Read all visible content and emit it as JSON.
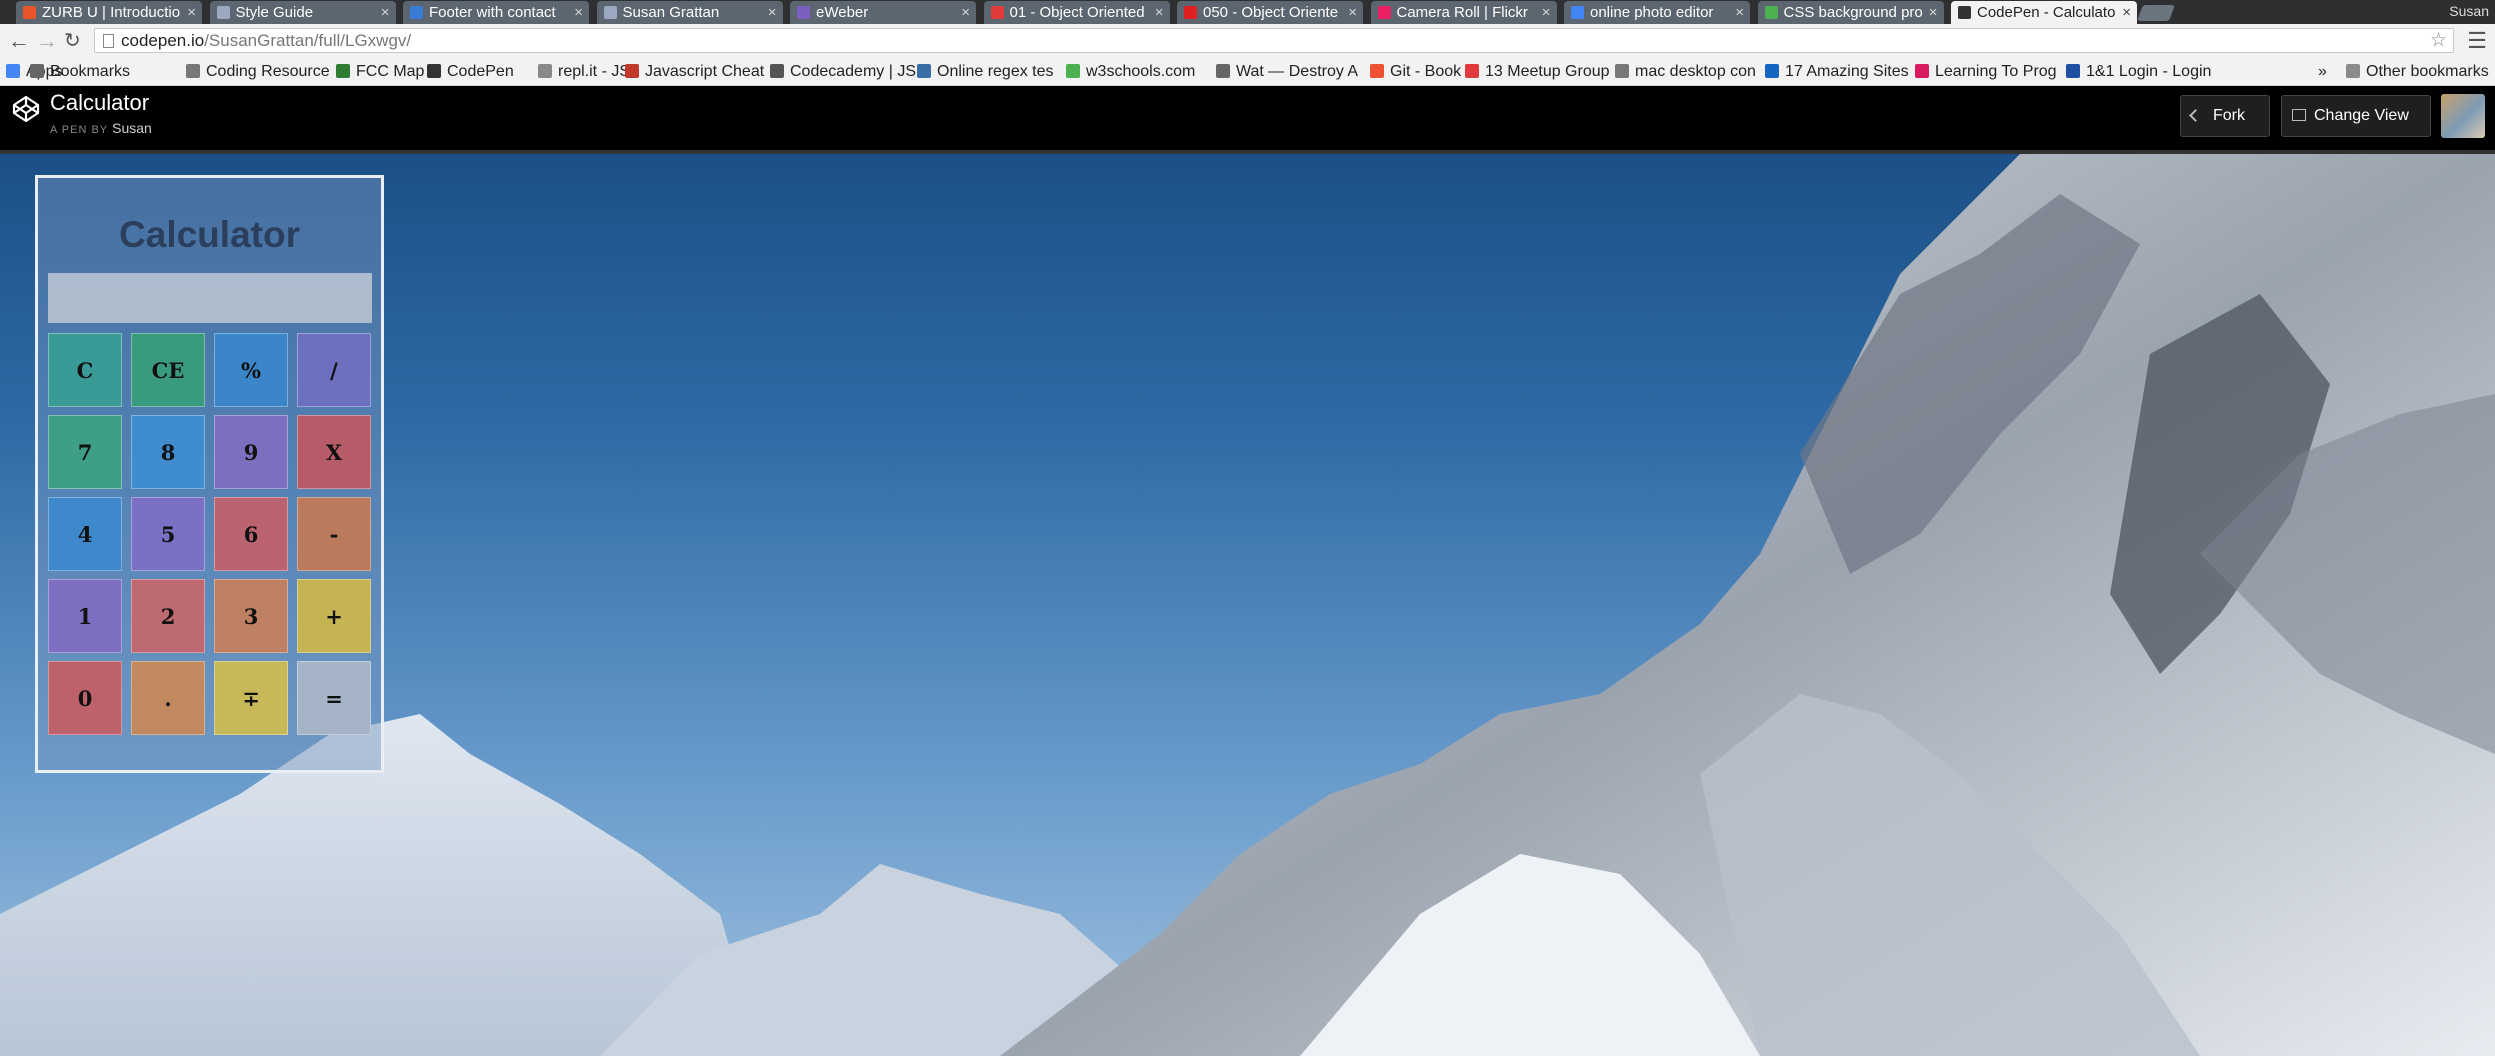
{
  "browser": {
    "tabs": [
      {
        "label": "ZURB U | Introductio",
        "favicon_color": "#e8552a"
      },
      {
        "label": "Style Guide",
        "favicon_color": "#9aa9c0"
      },
      {
        "label": "Footer with contact",
        "favicon_color": "#3a7bd5"
      },
      {
        "label": "Susan Grattan",
        "favicon_color": "#9aa9c0"
      },
      {
        "label": "eWeber",
        "favicon_color": "#7a5fbf"
      },
      {
        "label": "01 - Object Oriented",
        "favicon_color": "#e23b3b"
      },
      {
        "label": "050 - Object Oriente",
        "favicon_color": "#e02020"
      },
      {
        "label": "Camera Roll | Flickr",
        "favicon_color": "#e91e63"
      },
      {
        "label": "online photo editor",
        "favicon_color": "#4285f4"
      },
      {
        "label": "CSS background pro",
        "favicon_color": "#4caf50"
      },
      {
        "label": "CodePen - Calculato",
        "favicon_color": "#333333"
      }
    ],
    "user": "Susan",
    "url_host": "codepen.io",
    "url_path": "/SusanGrattan/full/LGxwgv/",
    "bookmarks": [
      {
        "label": "Apps",
        "color": "#4285f4"
      },
      {
        "label": "Bookmarks",
        "color": "#666666"
      },
      {
        "label": "Coding Resource",
        "color": "#777777"
      },
      {
        "label": "FCC Map",
        "color": "#2e7d32"
      },
      {
        "label": "CodePen",
        "color": "#333333"
      },
      {
        "label": "repl.it - JS",
        "color": "#888888"
      },
      {
        "label": "Javascript Cheat",
        "color": "#c0392b"
      },
      {
        "label": "Codecademy | JS",
        "color": "#555555"
      },
      {
        "label": "Online regex tes",
        "color": "#3a6ea5"
      },
      {
        "label": "w3schools.com",
        "color": "#4caf50"
      },
      {
        "label": "Wat — Destroy A",
        "color": "#666666"
      },
      {
        "label": "Git - Book",
        "color": "#f05133"
      },
      {
        "label": "13 Meetup Group",
        "color": "#e0393e"
      },
      {
        "label": "mac desktop con",
        "color": "#777777"
      },
      {
        "label": "17 Amazing Sites",
        "color": "#1565c0"
      },
      {
        "label": "Learning To Prog",
        "color": "#d81b60"
      },
      {
        "label": "1&1 Login - Login",
        "color": "#1e4fa3"
      }
    ],
    "more_bookmarks": "»",
    "other_bookmarks": "Other bookmarks"
  },
  "codepen": {
    "title": "Calculator",
    "byline": "A PEN BY",
    "author": "Susan",
    "fork_label": "Fork",
    "change_view_label": "Change View"
  },
  "calculator": {
    "title": "Calculator",
    "display": "",
    "keys": [
      {
        "label": "C",
        "color": "#3a9a95"
      },
      {
        "label": "CE",
        "color": "#3a9a7e"
      },
      {
        "label": "%",
        "color": "#3b86c8"
      },
      {
        "label": "/",
        "color": "#6c70bf"
      },
      {
        "label": "7",
        "color": "#3f9e86"
      },
      {
        "label": "8",
        "color": "#3f8ccf"
      },
      {
        "label": "9",
        "color": "#7d6fc0"
      },
      {
        "label": "X",
        "color": "#b65c68"
      },
      {
        "label": "4",
        "color": "#3e88cc"
      },
      {
        "label": "5",
        "color": "#7a70c4"
      },
      {
        "label": "6",
        "color": "#ba6470"
      },
      {
        "label": "-",
        "color": "#bb7a5c"
      },
      {
        "label": "1",
        "color": "#7e6fc2"
      },
      {
        "label": "2",
        "color": "#bd6a72"
      },
      {
        "label": "3",
        "color": "#bd8062"
      },
      {
        "label": "+",
        "color": "#c4b454"
      },
      {
        "label": "0",
        "color": "#bd626a"
      },
      {
        "label": ".",
        "color": "#c0895f"
      },
      {
        "label": "∓",
        "color": "#c7b85a"
      },
      {
        "label": "=",
        "color": "#a5b4c6"
      }
    ]
  }
}
